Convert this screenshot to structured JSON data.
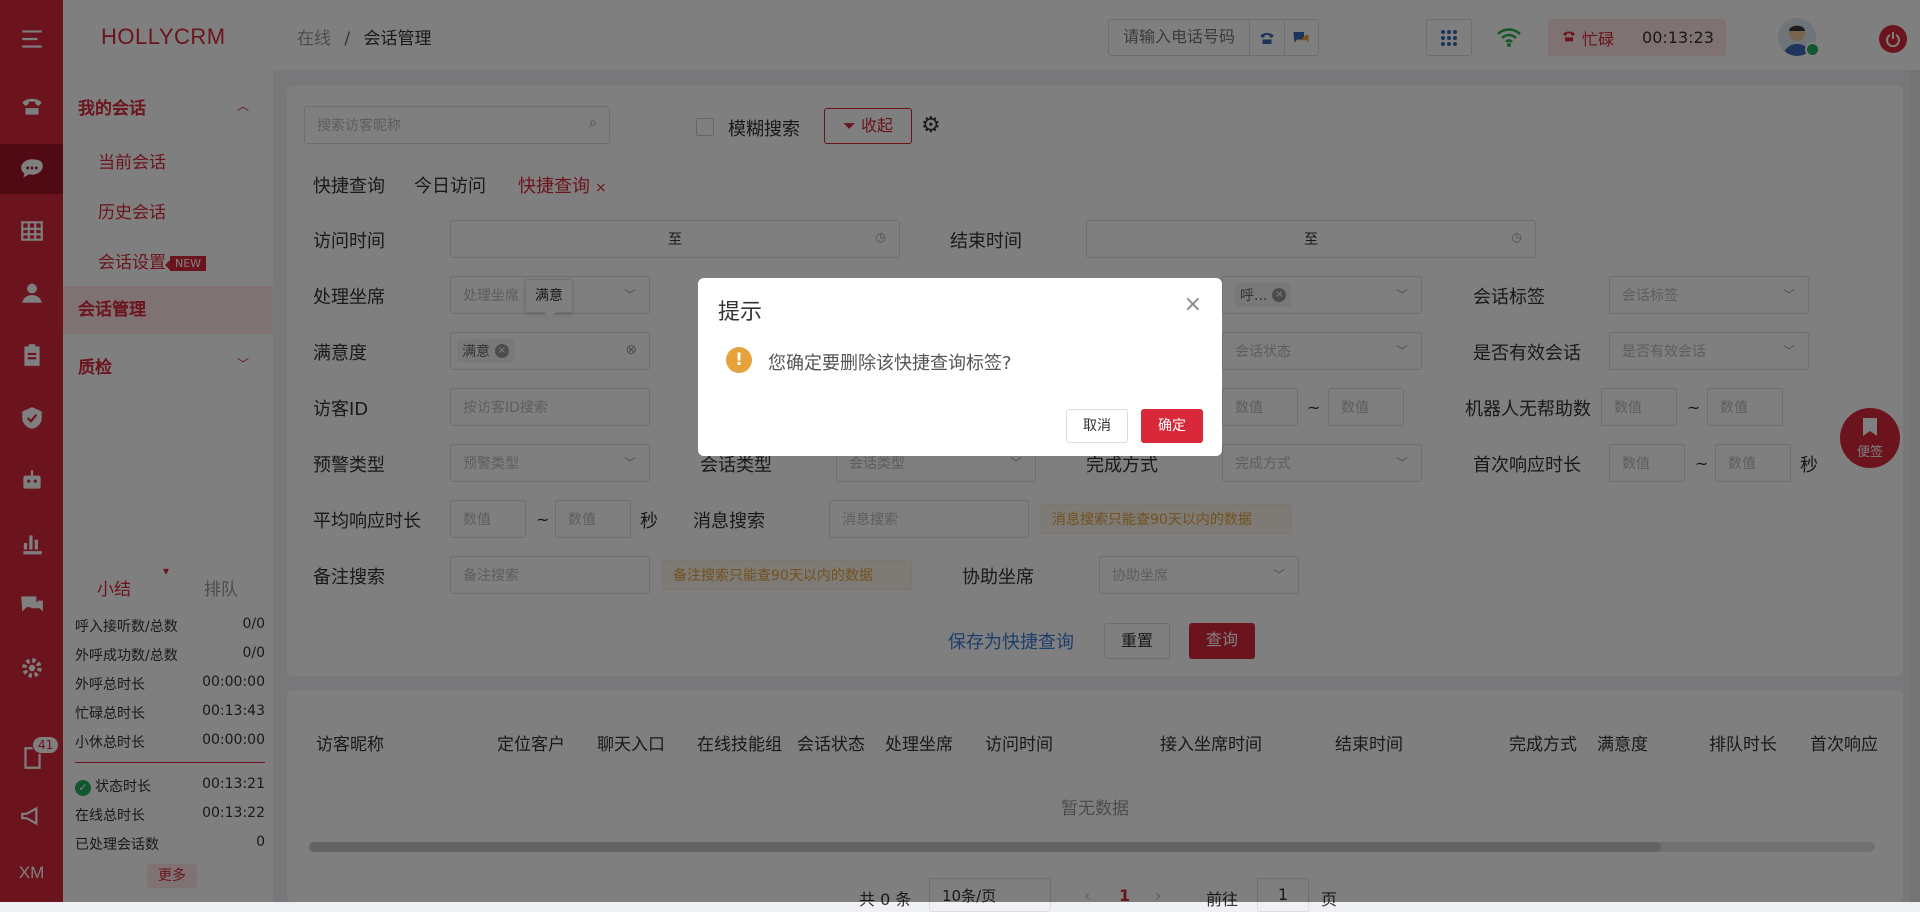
{
  "app": {
    "brand": "HOLLYCRM"
  },
  "rail": {
    "badge": "41",
    "bottom_label": "XM"
  },
  "sidebar": {
    "my_sessions": "我的会话",
    "current": "当前会话",
    "history": "历史会话",
    "settings": "会话设置",
    "new_badge": "NEW",
    "management": "会话管理",
    "quality": "质检",
    "tab_summary": "小结",
    "tab_queue": "排队",
    "stats": [
      {
        "label": "呼入接听数/总数",
        "value": "0/0"
      },
      {
        "label": "外呼成功数/总数",
        "value": "0/0"
      },
      {
        "label": "外呼总时长",
        "value": "00:00:00"
      },
      {
        "label": "忙碌总时长",
        "value": "00:13:43"
      },
      {
        "label": "小休总时长",
        "value": "00:00:00"
      }
    ],
    "stats2": [
      {
        "label": "状态时长",
        "value": "00:13:21"
      },
      {
        "label": "在线总时长",
        "value": "00:13:22"
      },
      {
        "label": "已处理会话数",
        "value": "0"
      }
    ],
    "more": "更多"
  },
  "topbar": {
    "crumb1": "在线",
    "crumb_sep": "/",
    "crumb2": "会话管理",
    "phone_placeholder": "请输入电话号码",
    "status": "忙碌",
    "timer": "00:13:23"
  },
  "filters": {
    "search_placeholder": "搜索访客昵称",
    "fuzzy": "模糊搜索",
    "collapse": "收起",
    "quick_query": "快捷查询",
    "today_visit": "今日访问",
    "quick_tag": "快捷查询",
    "visit_time": "访问时间",
    "to": "至",
    "end_time": "结束时间",
    "agent": "处理坐席",
    "agent_ph": "处理坐席",
    "session_tag": "会话标签",
    "session_tag_ph": "会话标签",
    "satisfaction": "满意度",
    "sat_tag": "满意",
    "status_ph": "会话状态",
    "valid_session": "是否有效会话",
    "valid_ph": "是否有效会话",
    "visitor_id": "访客ID",
    "visitor_id_ph": "按访客ID搜索",
    "num_ph": "数值",
    "tilde": "~",
    "robot_no_help": "机器人无帮助数",
    "alert_type": "预警类型",
    "alert_ph": "预警类型",
    "session_type": "会话类型",
    "session_type_ph": "会话类型",
    "complete_way": "完成方式",
    "complete_ph": "完成方式",
    "first_resp": "首次响应时长",
    "sec": "秒",
    "avg_resp": "平均响应时长",
    "msg_search": "消息搜索",
    "msg_ph": "消息搜索",
    "msg_warn": "消息搜索只能查90天以内的数据",
    "note_search": "备注搜索",
    "note_ph": "备注搜索",
    "note_warn": "备注搜索只能查90天以内的数据",
    "assist": "协助坐席",
    "assist_ph": "协助坐席",
    "call_tag": "呼...",
    "save_quick": "保存为快捷查询",
    "reset": "重置",
    "query": "查询",
    "tooltip": "满意"
  },
  "table": {
    "headers": [
      "访客昵称",
      "定位客户",
      "聊天入口",
      "在线技能组",
      "会话状态",
      "处理坐席",
      "访问时间",
      "接入坐席时间",
      "结束时间",
      "完成方式",
      "满意度",
      "排队时长",
      "首次响应"
    ],
    "empty": "暂无数据"
  },
  "pager": {
    "total": "共 0 条",
    "size": "10条/页",
    "page": "1",
    "goto": "前往",
    "goto_val": "1",
    "page_unit": "页"
  },
  "note_btn": "便签",
  "dialog": {
    "title": "提示",
    "message": "您确定要删除该快捷查询标签?",
    "cancel": "取消",
    "confirm": "确定"
  }
}
